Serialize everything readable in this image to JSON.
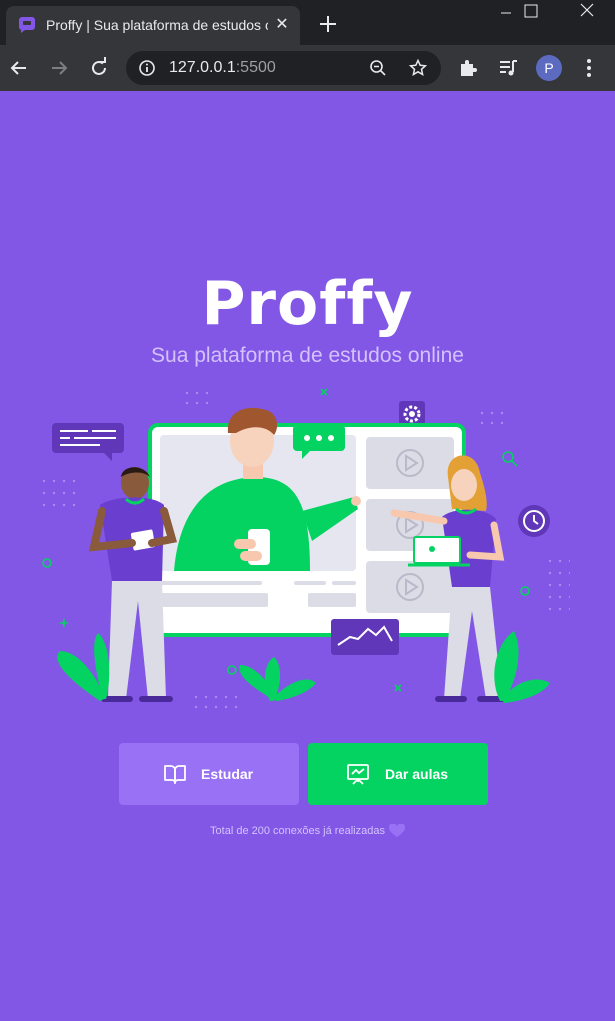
{
  "browser": {
    "tab_title": "Proffy | Sua plataforma de estudos online",
    "tab_close": "✕",
    "url_host": "127.0.0.1",
    "url_port": ":5500",
    "profile_initial": "P"
  },
  "page": {
    "logo": "Proffy",
    "tagline": "Sua plataforma de estudos online",
    "buttons": {
      "study": "Estudar",
      "give_classes": "Dar aulas"
    },
    "connections_text": "Total de 200 conexões já realizadas"
  },
  "colors": {
    "primary": "#8257e5",
    "primary_lighter": "#9871f5",
    "secondary": "#04d361",
    "text_in_primary": "#d4c2ff"
  }
}
